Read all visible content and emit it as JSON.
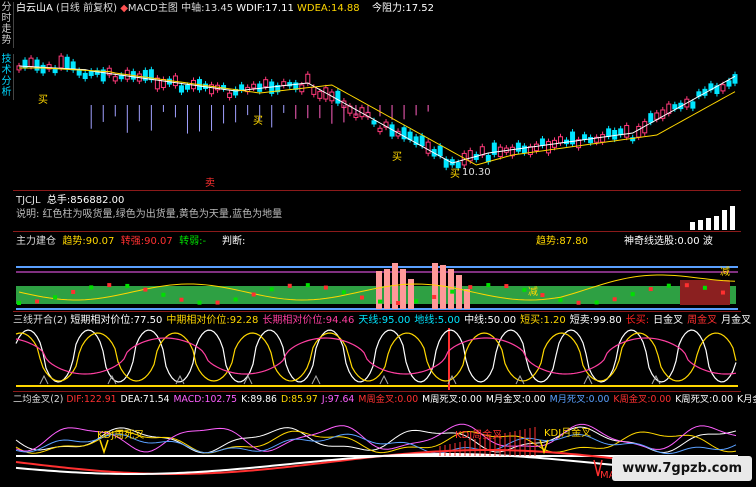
{
  "vtabs": {
    "tab1": "分时走势",
    "tab2": "技术分析"
  },
  "header": {
    "stock": "白云山A",
    "period": "(日线 前复权)",
    "indicator": "MACD主图",
    "mid_label": "中轴:",
    "mid_val": "13.45",
    "wdif_label": "WDIF:",
    "wdif_val": "17.11",
    "wdea_label": "WDEA:",
    "wdea_val": "14.88",
    "resist_label": "今阻力:",
    "resist_val": "17.52"
  },
  "price_chart": {
    "buy_label": "买",
    "sell_mark": "卖",
    "low_label": "10.30"
  },
  "tjcl": {
    "title": "TJCJL",
    "total_label": "总手:",
    "total_val": "856882.00",
    "desc": "说明: 红色柱为吸货量,绿色为出货量,黄色为天量,蓝色为地量"
  },
  "zljc": {
    "title": "主力建仓",
    "trend_label": "趋势:",
    "trend_val": "90.07",
    "turn_strong_label": "转强:",
    "turn_strong_val": "90.07",
    "turn_weak_label": "转弱:",
    "turn_weak_val": "-",
    "judge_label": "判断:",
    "trend2_label": "趋势:",
    "trend2_val": "87.80",
    "shenqi_label": "神奇线选股:",
    "shenqi_val": "0.00",
    "bo_label": "波",
    "jian": "减"
  },
  "sanxian": {
    "title": "三线开合(2)",
    "items": [
      {
        "label": "短期相对价位:",
        "val": "77.50",
        "color": "#ffffff"
      },
      {
        "label": "中期相对价位:",
        "val": "92.28",
        "color": "#ffd700"
      },
      {
        "label": "长期相对价位:",
        "val": "94.46",
        "color": "#ff3fa0"
      },
      {
        "label": "天线:",
        "val": "95.00",
        "color": "#00e5ff"
      },
      {
        "label": "地线:",
        "val": "5.00",
        "color": "#00e5ff"
      },
      {
        "label": "中线:",
        "val": "50.00",
        "color": "#ffffff"
      },
      {
        "label": "短买:",
        "val": "1.20",
        "color": "#ffd700"
      },
      {
        "label": "短卖:",
        "val": "99.80",
        "color": "#ffffff"
      },
      {
        "label": "长买:",
        "val": "",
        "color": "#ff2020"
      },
      {
        "label": "日金叉",
        "val": "",
        "color": "#ffffff"
      },
      {
        "label": "周金叉",
        "val": "",
        "color": "#ff3030"
      },
      {
        "label": "月金叉",
        "val": "",
        "color": "#ffffff"
      }
    ]
  },
  "erjin": {
    "title": "二均金叉(2)",
    "items": [
      {
        "label": "DIF:",
        "val": "122.91",
        "color": "#ff3030"
      },
      {
        "label": "DEA:",
        "val": "71.54",
        "color": "#ffffff"
      },
      {
        "label": "MACD:",
        "val": "102.75",
        "color": "#ff60ff"
      },
      {
        "label": "K:",
        "val": "89.86",
        "color": "#ffffff"
      },
      {
        "label": "D:",
        "val": "85.97",
        "color": "#ffd700"
      },
      {
        "label": "J:",
        "val": "97.64",
        "color": "#ff60ff"
      },
      {
        "label": "M周金叉:",
        "val": "0.00",
        "color": "#ff3030"
      },
      {
        "label": "M周死叉:",
        "val": "0.00",
        "color": "#ffffff"
      },
      {
        "label": "M月金叉:",
        "val": "0.00",
        "color": "#ffffff"
      },
      {
        "label": "M月死叉:",
        "val": "0.00",
        "color": "#5aa0ff"
      },
      {
        "label": "K周金叉:",
        "val": "0.00",
        "color": "#ff3030"
      },
      {
        "label": "K周死叉:",
        "val": "0.00",
        "color": "#ffffff"
      },
      {
        "label": "K月金叉:",
        "val": "",
        "color": "#ffffff"
      }
    ],
    "kdj_dead": "KDJ周死叉",
    "kdj_gold_week": "KDJ周金叉",
    "kdj_gold_month": "KDJ月金叉",
    "mai": "MAI"
  },
  "watermark": "www.7gpzb.com"
}
